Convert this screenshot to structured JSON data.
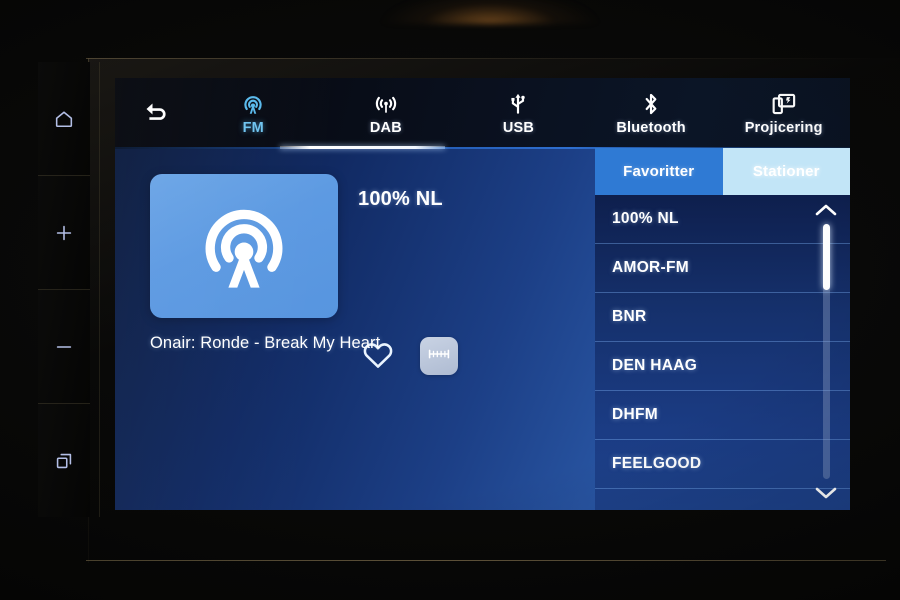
{
  "device": {
    "hardware_keys": [
      {
        "name": "home",
        "icon": "home-icon"
      },
      {
        "name": "volume-up",
        "icon": "plus-icon"
      },
      {
        "name": "volume-down",
        "icon": "minus-icon"
      },
      {
        "name": "apps",
        "icon": "windows-icon"
      }
    ]
  },
  "topbar": {
    "back_icon": "back-arrow-icon",
    "sources": [
      {
        "label": "FM",
        "icon": "radio-tower-icon",
        "active": true
      },
      {
        "label": "DAB",
        "icon": "antenna-waves-icon",
        "active": false
      },
      {
        "label": "USB",
        "icon": "usb-icon",
        "active": false
      },
      {
        "label": "Bluetooth",
        "icon": "bluetooth-icon",
        "active": false
      },
      {
        "label": "Projicering",
        "icon": "screen-mirroring-icon",
        "active": false
      }
    ]
  },
  "now_playing": {
    "artwork_icon": "radio-tower-icon",
    "station": "100% NL",
    "onair_text": "Onair: Ronde - Break My Heart",
    "favorite_icon": "heart-outline-icon",
    "favorite_active": false,
    "tune_icon": "frequency-dial-icon"
  },
  "list_pane": {
    "tabs": [
      {
        "label": "Favoritter",
        "selected": true
      },
      {
        "label": "Stationer",
        "selected": false
      }
    ],
    "stations": [
      "100% NL",
      "AMOR-FM",
      "BNR",
      "DEN HAAG",
      "DHFM",
      "FEELGOOD"
    ],
    "scrollbar": {
      "up_icon": "chevron-up-icon",
      "down_icon": "chevron-down-icon",
      "thumb_position_percent": 0,
      "thumb_size_percent": 26
    }
  },
  "colors": {
    "accent_active": "#59b9ec",
    "tab_selected_bg": "#2f7ad4",
    "tab_unselected_bg": "#c2e5f7",
    "artwork_bg": "#5d9ae2",
    "list_bg": "#15306b",
    "text": "#ffffff"
  }
}
